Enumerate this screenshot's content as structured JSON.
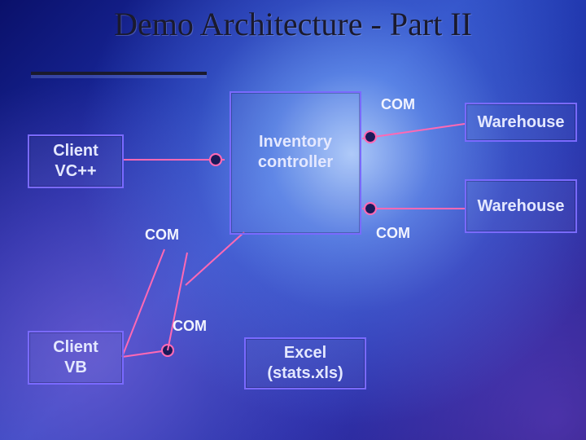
{
  "title": "Demo Architecture - Part II",
  "boxes": {
    "client_vcpp": "Client\nVC++",
    "client_vb": "Client\nVB",
    "inventory": "Inventory\ncontroller",
    "excel": "Excel\n(stats.xls)",
    "warehouse1": "Warehouse",
    "warehouse2": "Warehouse"
  },
  "labels": {
    "com_top": "COM",
    "com_mid_left": "COM",
    "com_mid_right": "COM",
    "com_bottom": "COM"
  }
}
